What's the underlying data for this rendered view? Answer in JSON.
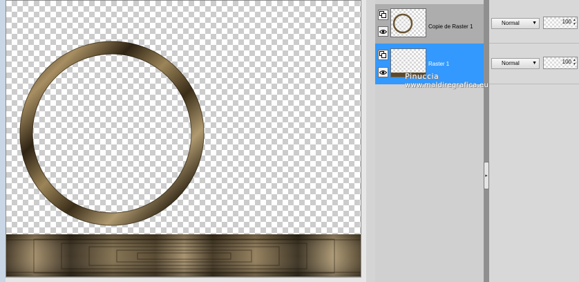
{
  "canvas": {
    "frame_color": "#7a6440"
  },
  "layers": [
    {
      "name": "Copie de Raster 1",
      "selected": false,
      "blend_mode": "Normal",
      "opacity": "100"
    },
    {
      "name": "Raster 1",
      "selected": true,
      "blend_mode": "Normal",
      "opacity": "100"
    }
  ],
  "watermark": {
    "line1": "Pinuccia",
    "line2": "www.maldiregrafica.eu"
  },
  "colors": {
    "selected_layer": "#3399ff",
    "bronze_light": "#b09a70",
    "bronze_dark": "#2f2414"
  },
  "icons": {
    "layer_group": "layer-group-icon",
    "visibility": "eye-icon",
    "dropdown": "chevron-down-icon",
    "splitter": "chevron-right-icon"
  }
}
